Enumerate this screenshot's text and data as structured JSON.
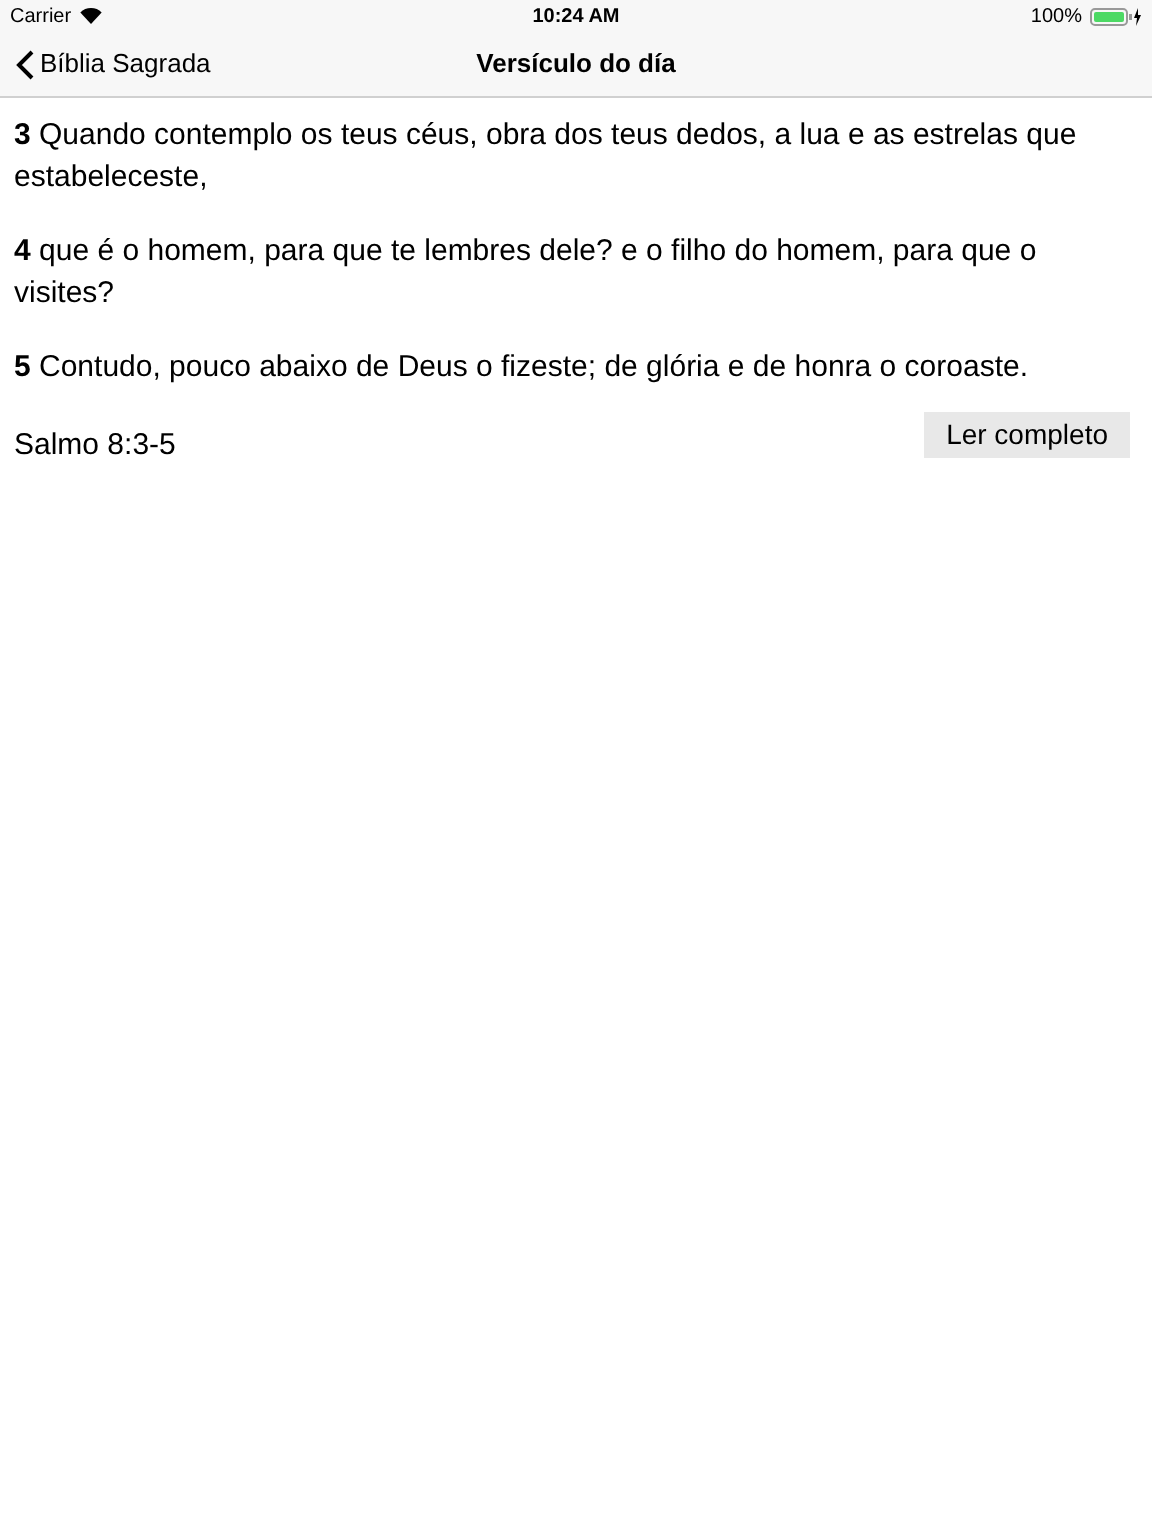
{
  "status_bar": {
    "carrier": "Carrier",
    "time": "10:24 AM",
    "battery": "100%"
  },
  "nav_bar": {
    "back_label": "Bíblia Sagrada",
    "title": "Versículo do día"
  },
  "verses": [
    {
      "text": "**3** Quando contemplo os teus céus, obra dos teus dedos, a lua e as estrelas que estabeleceste,"
    },
    {
      "text": "**4** que é o homem, para que te lembres dele? e o filho do homem, para que o visites?"
    },
    {
      "text": "**5** Contudo, pouco abaixo de Deus o fizeste; de glória e de honra o coroaste."
    }
  ],
  "reference": "Salmo 8:3-5",
  "read_button": "Ler completo"
}
